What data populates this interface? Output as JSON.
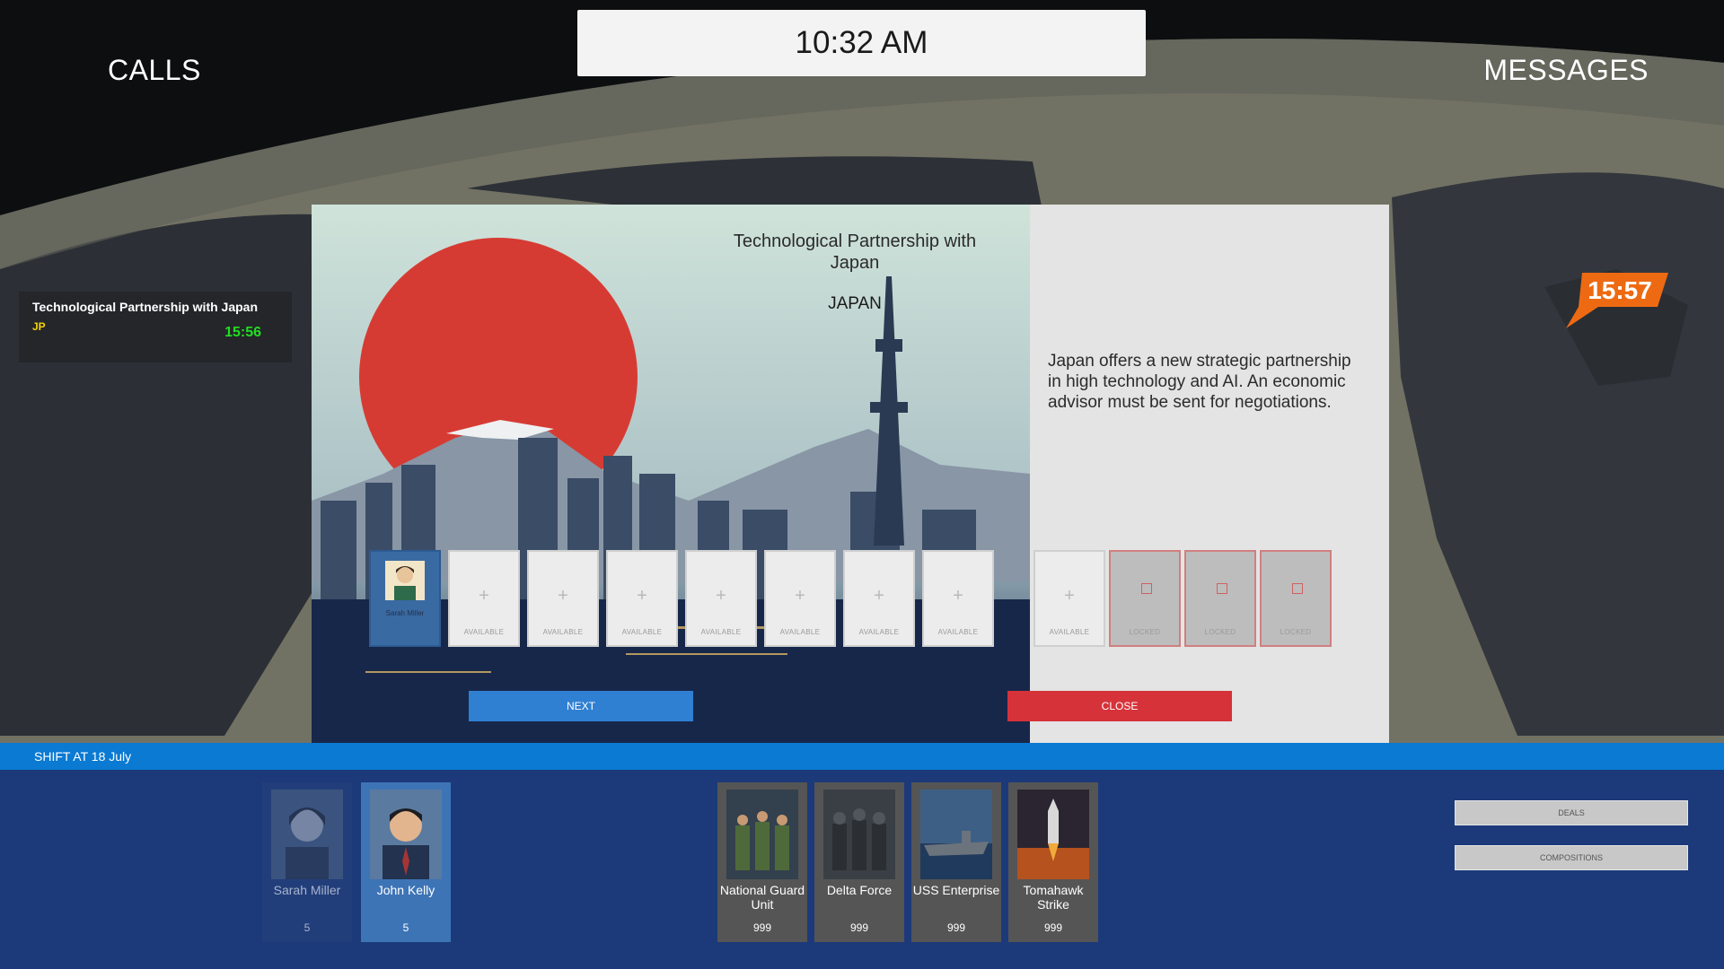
{
  "header": {
    "clock": "10:32 AM",
    "calls_label": "CALLS",
    "messages_label": "MESSAGES"
  },
  "call_card": {
    "title": "Technological Partnership with Japan",
    "country_code": "JP",
    "timer": "15:56"
  },
  "map_marker": {
    "timer": "15:57",
    "color": "#ee6a12"
  },
  "modal": {
    "title": "Technological Partnership with Japan",
    "country": "JAPAN",
    "description": "Japan offers a new strategic partnership in high technology and AI. An economic advisor must be sent for negotiations.",
    "slots": [
      {
        "state": "occupied",
        "name": "Sarah Miller"
      },
      {
        "state": "available",
        "label": "AVAILABLE"
      },
      {
        "state": "available",
        "label": "AVAILABLE"
      },
      {
        "state": "available",
        "label": "AVAILABLE"
      },
      {
        "state": "available",
        "label": "AVAILABLE"
      },
      {
        "state": "available",
        "label": "AVAILABLE"
      },
      {
        "state": "available",
        "label": "AVAILABLE"
      },
      {
        "state": "available",
        "label": "AVAILABLE"
      },
      {
        "state": "available",
        "label": "AVAILABLE"
      },
      {
        "state": "locked",
        "label": "LOCKED"
      },
      {
        "state": "locked",
        "label": "LOCKED"
      },
      {
        "state": "locked",
        "label": "LOCKED"
      }
    ],
    "next_label": "NEXT",
    "close_label": "CLOSE"
  },
  "shift": {
    "label": "SHIFT AT 18 July"
  },
  "agents": [
    {
      "name": "Sarah Miller",
      "value": "5"
    },
    {
      "name": "John Kelly",
      "value": "5"
    }
  ],
  "units": [
    {
      "name": "National Guard Unit",
      "value": "999",
      "icon": "soldiers-icon"
    },
    {
      "name": "Delta Force",
      "value": "999",
      "icon": "special-forces-icon"
    },
    {
      "name": "USS Enterprise",
      "value": "999",
      "icon": "carrier-icon"
    },
    {
      "name": "Tomahawk Strike",
      "value": "999",
      "icon": "missile-icon"
    }
  ],
  "side_buttons": {
    "deals": "DEALS",
    "compositions": "COMPOSITIONS"
  },
  "colors": {
    "accent_blue": "#0a7ad2",
    "close_red": "#d6323a",
    "next_blue": "#2f80d2",
    "timer_green": "#22dd22"
  }
}
